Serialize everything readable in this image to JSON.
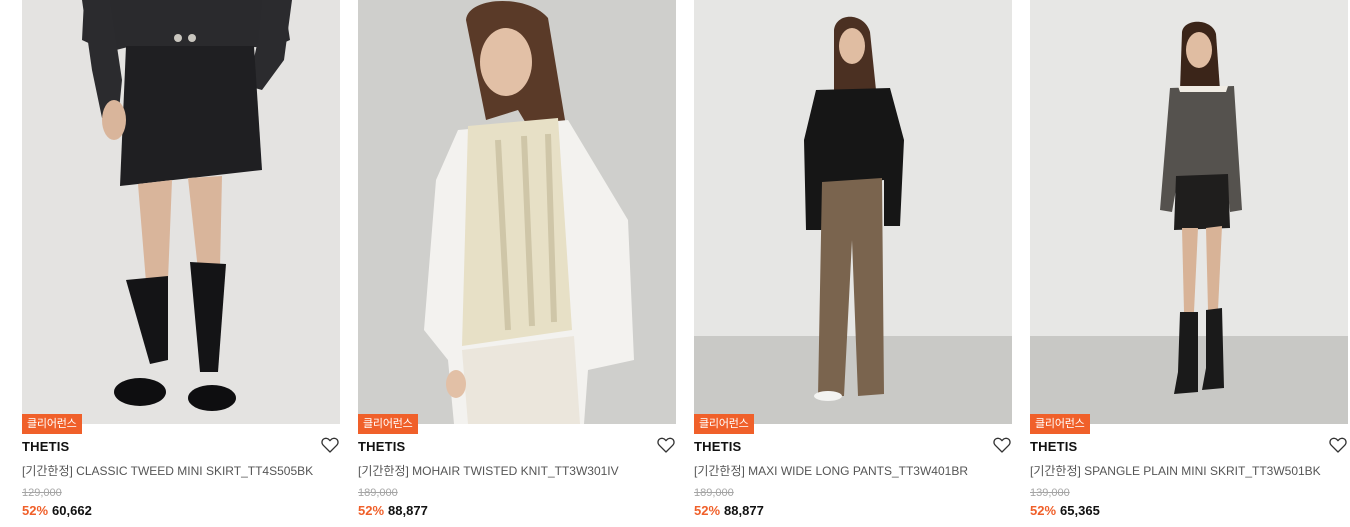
{
  "products": [
    {
      "badge": "클리어런스",
      "brand": "THETIS",
      "name": "[기간한정] CLASSIC TWEED MINI SKIRT_TT4S505BK",
      "original_price": "129,000",
      "discount": "52%",
      "sale_price": "60,662",
      "wish_icon": "heart-outline-icon"
    },
    {
      "badge": "클리어런스",
      "brand": "THETIS",
      "name": "[기간한정] MOHAIR TWISTED KNIT_TT3W301IV",
      "original_price": "189,000",
      "discount": "52%",
      "sale_price": "88,877",
      "wish_icon": "heart-outline-icon"
    },
    {
      "badge": "클리어런스",
      "brand": "THETIS",
      "name": "[기간한정] MAXI WIDE LONG PANTS_TT3W401BR",
      "original_price": "189,000",
      "discount": "52%",
      "sale_price": "88,877",
      "wish_icon": "heart-outline-icon"
    },
    {
      "badge": "클리어런스",
      "brand": "THETIS",
      "name": "[기간한정] SPANGLE PLAIN MINI SKRIT_TT3W501BK",
      "original_price": "139,000",
      "discount": "52%",
      "sale_price": "65,365",
      "wish_icon": "heart-outline-icon"
    }
  ],
  "colors": {
    "accent": "#f0602a",
    "price_text": "#111111",
    "muted_text": "#a5a5a5"
  }
}
